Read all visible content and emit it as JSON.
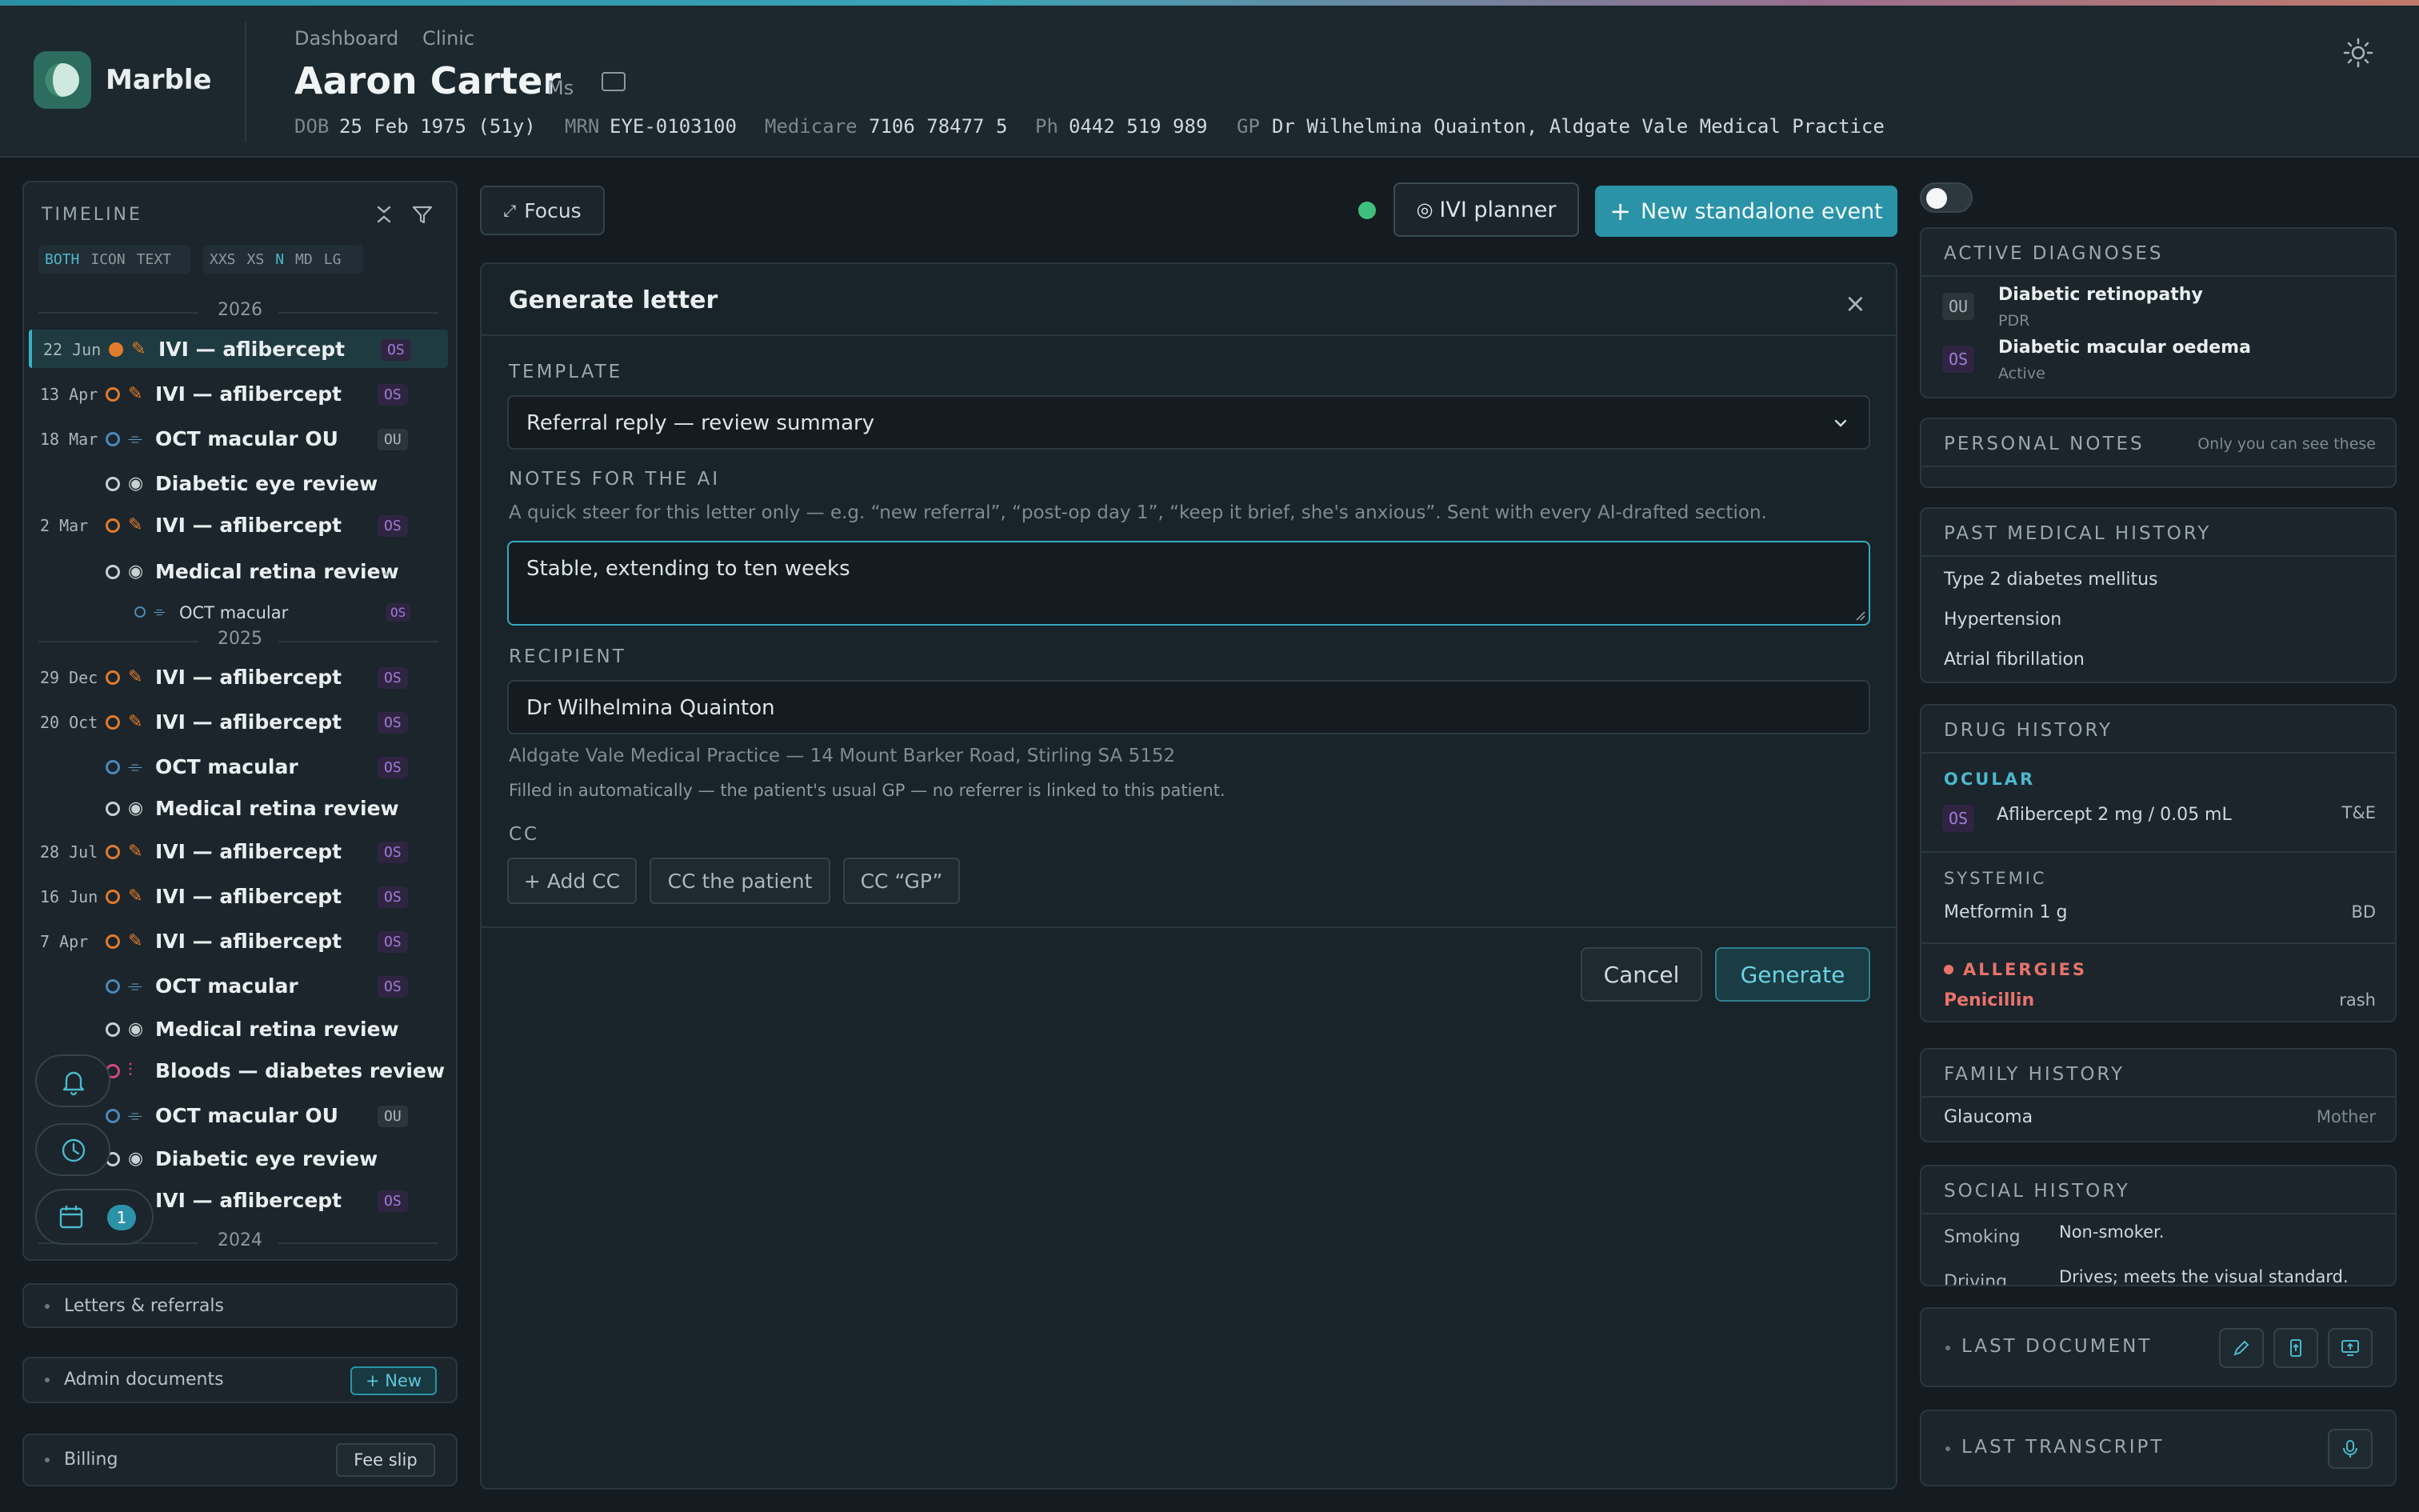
{
  "app": {
    "name": "Marble"
  },
  "breadcrumb": [
    "Dashboard",
    "Clinic"
  ],
  "patient": {
    "name": "Aaron Carter",
    "title": "Ms",
    "dob_label": "DOB",
    "dob": "25 Feb 1975 (51y)",
    "mrn_label": "MRN",
    "mrn": "EYE-0103100",
    "medicare_label": "Medicare",
    "medicare": "7106 78477 5",
    "ph_label": "Ph",
    "ph": "0442 519 989",
    "gp_label": "GP",
    "gp": "Dr Wilhelmina Quainton, Aldgate Vale Medical Practice"
  },
  "timeline": {
    "title": "TIMELINE",
    "view_modes": [
      "BOTH",
      "ICON",
      "TEXT"
    ],
    "active_view": "BOTH",
    "sizes": [
      "XXS",
      "XS",
      "N",
      "MD",
      "LG"
    ],
    "active_size": "N",
    "years": [
      "2026",
      "2025",
      "2024"
    ],
    "events": [
      {
        "date": "22 Jun",
        "label": "IVI — aflibercept",
        "eye": "OS",
        "kind": "ivi",
        "selected": true
      },
      {
        "date": "13 Apr",
        "label": "IVI — aflibercept",
        "eye": "OS",
        "kind": "ivi"
      },
      {
        "date": "18 Mar",
        "label": "OCT macular OU",
        "eye": "OU",
        "kind": "oct"
      },
      {
        "date": "",
        "label": "Diabetic eye review",
        "eye": "",
        "kind": "review"
      },
      {
        "date": "2 Mar",
        "label": "IVI — aflibercept",
        "eye": "OS",
        "kind": "ivi"
      },
      {
        "date": "",
        "label": "Medical retina review",
        "eye": "",
        "kind": "review"
      },
      {
        "date": "",
        "label": "OCT macular",
        "eye": "OS",
        "kind": "oct-child"
      },
      {
        "date": "29 Dec",
        "label": "IVI — aflibercept",
        "eye": "OS",
        "kind": "ivi"
      },
      {
        "date": "20 Oct",
        "label": "IVI — aflibercept",
        "eye": "OS",
        "kind": "ivi"
      },
      {
        "date": "",
        "label": "OCT macular",
        "eye": "OS",
        "kind": "oct"
      },
      {
        "date": "",
        "label": "Medical retina review",
        "eye": "",
        "kind": "review"
      },
      {
        "date": "28 Jul",
        "label": "IVI — aflibercept",
        "eye": "OS",
        "kind": "ivi"
      },
      {
        "date": "16 Jun",
        "label": "IVI — aflibercept",
        "eye": "OS",
        "kind": "ivi"
      },
      {
        "date": "7 Apr",
        "label": "IVI — aflibercept",
        "eye": "OS",
        "kind": "ivi"
      },
      {
        "date": "",
        "label": "OCT macular",
        "eye": "OS",
        "kind": "oct"
      },
      {
        "date": "",
        "label": "Medical retina review",
        "eye": "",
        "kind": "review"
      },
      {
        "date": "",
        "label": "Bloods — diabetes review",
        "eye": "",
        "kind": "bloods"
      },
      {
        "date": "",
        "label": "OCT macular OU",
        "eye": "OU",
        "kind": "oct"
      },
      {
        "date": "",
        "label": "Diabetic eye review",
        "eye": "",
        "kind": "review"
      },
      {
        "date": "",
        "label": "IVI — aflibercept",
        "eye": "OS",
        "kind": "ivi"
      }
    ],
    "calendar_count": "1"
  },
  "sections": {
    "letters": "Letters & referrals",
    "admin": "Admin documents",
    "admin_new": "+ New",
    "billing": "Billing",
    "fee_slip": "Fee slip"
  },
  "toolbar": {
    "focus": "Focus",
    "ivi_planner": "IVI planner",
    "new_event": "New standalone event"
  },
  "modal": {
    "title": "Generate letter",
    "template_label": "TEMPLATE",
    "template_value": "Referral reply — review summary",
    "notes_label": "NOTES FOR THE AI",
    "notes_hint": "A quick steer for this letter only — e.g. “new referral”, “post-op day 1”, “keep it brief, she's anxious”. Sent with every AI-drafted section.",
    "notes_value": "Stable, extending to ten weeks",
    "recipient_label": "RECIPIENT",
    "recipient_value": "Dr Wilhelmina Quainton",
    "recipient_address": "Aldgate Vale Medical Practice — 14 Mount Barker Road, Stirling SA 5152",
    "recipient_note": "Filled in automatically — the patient's usual GP — no referrer is linked to this patient.",
    "cc_label": "CC",
    "cc_buttons": [
      "+ Add CC",
      "CC the patient",
      "CC “GP”"
    ],
    "cancel": "Cancel",
    "generate": "Generate"
  },
  "right": {
    "active_diagnoses": {
      "title": "ACTIVE DIAGNOSES",
      "items": [
        {
          "eye": "OU",
          "name": "Diabetic retinopathy",
          "status": "PDR"
        },
        {
          "eye": "OS",
          "name": "Diabetic macular oedema",
          "status": "Active"
        }
      ]
    },
    "personal_notes": {
      "title": "PERSONAL NOTES",
      "hint": "Only you can see these"
    },
    "pmh": {
      "title": "PAST MEDICAL HISTORY",
      "items": [
        "Type 2 diabetes mellitus",
        "Hypertension",
        "Atrial fibrillation"
      ]
    },
    "drugs": {
      "title": "DRUG HISTORY",
      "ocular_label": "OCULAR",
      "ocular": [
        {
          "eye": "OS",
          "name": "Aflibercept 2 mg / 0.05 mL",
          "freq": "T&E"
        }
      ],
      "systemic_label": "SYSTEMIC",
      "systemic": [
        {
          "name": "Metformin 1 g",
          "freq": "BD"
        }
      ],
      "allergies_label": "ALLERGIES",
      "allergies": [
        {
          "name": "Penicillin",
          "reaction": "rash"
        }
      ]
    },
    "family": {
      "title": "FAMILY HISTORY",
      "items": [
        {
          "name": "Glaucoma",
          "relation": "Mother"
        }
      ]
    },
    "social": {
      "title": "SOCIAL HISTORY",
      "items": [
        {
          "key": "Smoking",
          "value": "Non-smoker."
        },
        {
          "key": "Driving",
          "value": "Drives; meets the visual standard."
        }
      ]
    },
    "last_document": "LAST DOCUMENT",
    "last_transcript": "LAST TRANSCRIPT"
  },
  "colors": {
    "accent": "#2a93a8",
    "ivi": "#e07b2c",
    "os_badge": "#a07ad6",
    "allergy": "#e8736b",
    "ocular": "#4bb8cc"
  }
}
